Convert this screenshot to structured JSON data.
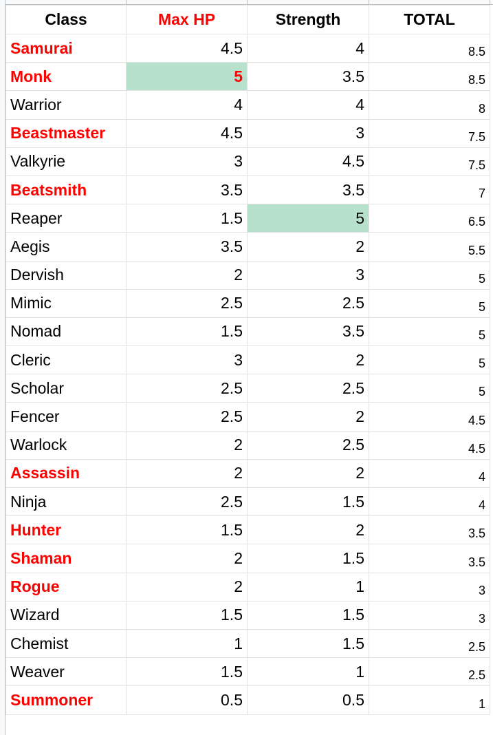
{
  "sheet": {
    "headers": [
      {
        "label": "Class",
        "color": "#000000"
      },
      {
        "label": "Max HP",
        "color": "#ff0000"
      },
      {
        "label": "Strength",
        "color": "#000000"
      },
      {
        "label": "TOTAL",
        "color": "#000000"
      }
    ],
    "highlight_color": "#b7e1cd",
    "rows": [
      {
        "class": "Samurai",
        "red": true,
        "max_hp": "4.5",
        "strength": "4",
        "total": "8.5"
      },
      {
        "class": "Monk",
        "red": true,
        "max_hp": "5",
        "strength": "3.5",
        "total": "8.5",
        "hp_highlight": true,
        "hp_red_bold": true
      },
      {
        "class": "Warrior",
        "red": false,
        "max_hp": "4",
        "strength": "4",
        "total": "8"
      },
      {
        "class": "Beastmaster",
        "red": true,
        "max_hp": "4.5",
        "strength": "3",
        "total": "7.5"
      },
      {
        "class": "Valkyrie",
        "red": false,
        "max_hp": "3",
        "strength": "4.5",
        "total": "7.5"
      },
      {
        "class": "Beatsmith",
        "red": true,
        "max_hp": "3.5",
        "strength": "3.5",
        "total": "7"
      },
      {
        "class": "Reaper",
        "red": false,
        "max_hp": "1.5",
        "strength": "5",
        "total": "6.5",
        "str_highlight": true
      },
      {
        "class": "Aegis",
        "red": false,
        "max_hp": "3.5",
        "strength": "2",
        "total": "5.5"
      },
      {
        "class": "Dervish",
        "red": false,
        "max_hp": "2",
        "strength": "3",
        "total": "5"
      },
      {
        "class": "Mimic",
        "red": false,
        "max_hp": "2.5",
        "strength": "2.5",
        "total": "5"
      },
      {
        "class": "Nomad",
        "red": false,
        "max_hp": "1.5",
        "strength": "3.5",
        "total": "5"
      },
      {
        "class": "Cleric",
        "red": false,
        "max_hp": "3",
        "strength": "2",
        "total": "5"
      },
      {
        "class": "Scholar",
        "red": false,
        "max_hp": "2.5",
        "strength": "2.5",
        "total": "5"
      },
      {
        "class": "Fencer",
        "red": false,
        "max_hp": "2.5",
        "strength": "2",
        "total": "4.5"
      },
      {
        "class": "Warlock",
        "red": false,
        "max_hp": "2",
        "strength": "2.5",
        "total": "4.5"
      },
      {
        "class": "Assassin",
        "red": true,
        "max_hp": "2",
        "strength": "2",
        "total": "4"
      },
      {
        "class": "Ninja",
        "red": false,
        "max_hp": "2.5",
        "strength": "1.5",
        "total": "4"
      },
      {
        "class": "Hunter",
        "red": true,
        "max_hp": "1.5",
        "strength": "2",
        "total": "3.5"
      },
      {
        "class": "Shaman",
        "red": true,
        "max_hp": "2",
        "strength": "1.5",
        "total": "3.5"
      },
      {
        "class": "Rogue",
        "red": true,
        "max_hp": "2",
        "strength": "1",
        "total": "3"
      },
      {
        "class": "Wizard",
        "red": false,
        "max_hp": "1.5",
        "strength": "1.5",
        "total": "3"
      },
      {
        "class": "Chemist",
        "red": false,
        "max_hp": "1",
        "strength": "1.5",
        "total": "2.5"
      },
      {
        "class": "Weaver",
        "red": false,
        "max_hp": "1.5",
        "strength": "1",
        "total": "2.5"
      },
      {
        "class": "Summoner",
        "red": true,
        "max_hp": "0.5",
        "strength": "0.5",
        "total": "1"
      }
    ]
  }
}
